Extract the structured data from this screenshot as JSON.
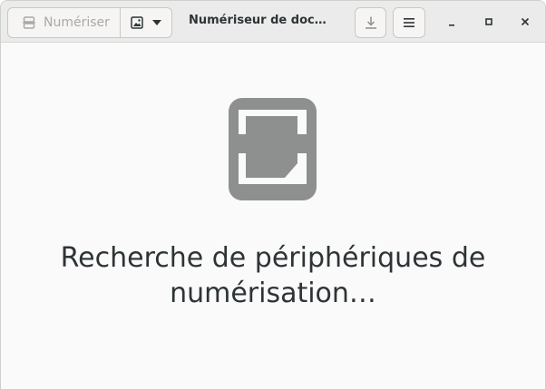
{
  "header": {
    "scan_label": "Numériser",
    "title": "Numériseur de doc…"
  },
  "icons": {
    "scan": "scanner-icon",
    "document_type": "image-icon",
    "dropdown": "chevron-down-icon",
    "save": "download-icon",
    "menu": "hamburger-menu-icon",
    "minimize": "minimize-icon",
    "maximize": "maximize-icon",
    "close": "close-icon",
    "status": "scanner-device-icon"
  },
  "main": {
    "status_message": "Recherche de périphériques de numérisation…"
  },
  "colors": {
    "headerbar": "#ebebeb",
    "content_bg": "#fafafa",
    "icon_gray": "#8e8f8f",
    "text": "#2e3436"
  }
}
